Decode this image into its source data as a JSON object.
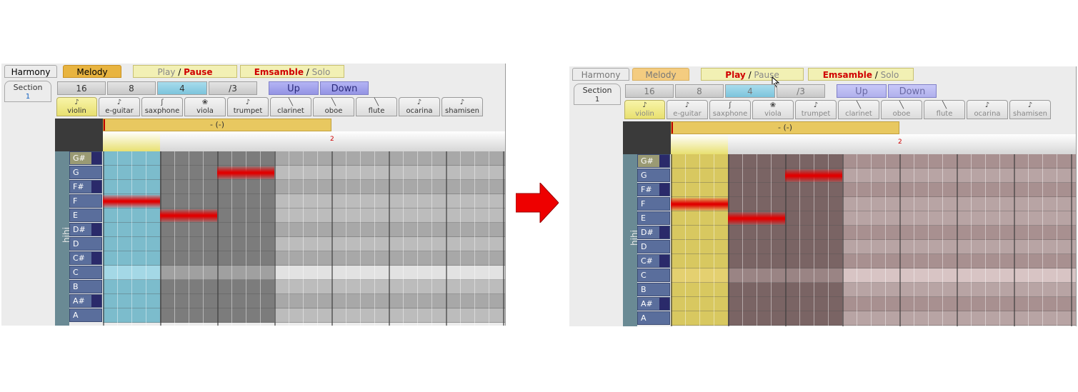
{
  "tabs": {
    "harmony": "Harmony",
    "melody": "Melody"
  },
  "play": {
    "play": "Play",
    "slash": " / ",
    "pause": "Pause"
  },
  "ensemble": {
    "ensemble": "Emsamble",
    "slash": " / ",
    "solo": "Solo"
  },
  "section": {
    "label": "Section",
    "value": "1"
  },
  "divisions": [
    "16",
    "8",
    "4",
    "/3"
  ],
  "nav": {
    "up": "Up",
    "down": "Down"
  },
  "instruments": [
    "violin",
    "e-guitar",
    "saxphone",
    "viola",
    "trumpet",
    "clarinet",
    "oboe",
    "flute",
    "ocarina",
    "shamisen"
  ],
  "icons": [
    "violin-icon",
    "guitar-icon",
    "saxophone-icon",
    "viola-icon",
    "trumpet-icon",
    "clarinet-icon",
    "oboe-icon",
    "flute-icon",
    "ocarina-icon",
    "shamisen-icon"
  ],
  "sequence_label": "- (-)",
  "ruler_mark": "2",
  "track_name": "hihi",
  "keys": [
    "G#",
    "G",
    "F#",
    "F",
    "E",
    "D#",
    "D",
    "C#",
    "C",
    "B",
    "A#",
    "A"
  ],
  "notes": [
    {
      "key": "F",
      "start_step": 0,
      "length_steps": 4
    },
    {
      "key": "E",
      "start_step": 4,
      "length_steps": 4
    },
    {
      "key": "G",
      "start_step": 8,
      "length_steps": 4
    }
  ],
  "colors": {
    "before_highlight_column": "#7cbccc",
    "after_highlight_column": "#d8c860",
    "after_tint": "#7a6464",
    "note": "#e00000",
    "arrow": "#ee0000"
  },
  "state_before": {
    "selected_division": "4",
    "selected_instrument": "violin"
  },
  "state_after": {
    "selected_division": "4",
    "selected_instrument": "violin"
  }
}
